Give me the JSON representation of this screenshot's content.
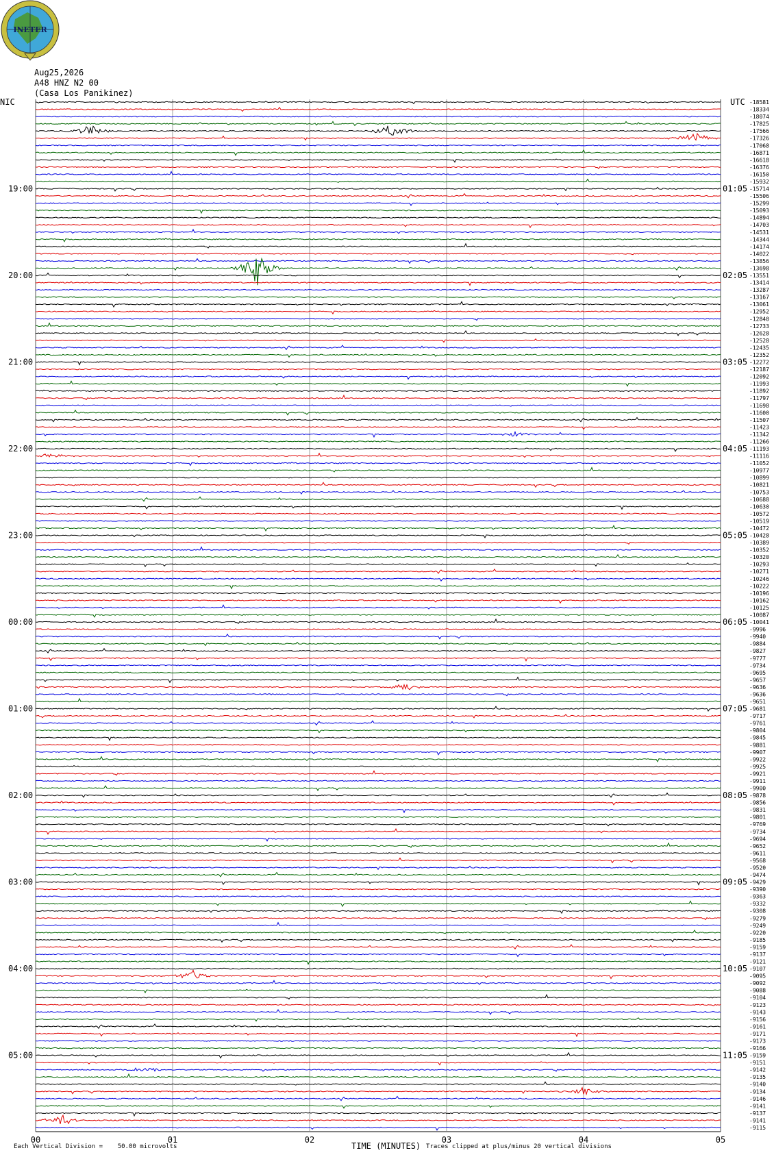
{
  "logo": {
    "text": "INETER"
  },
  "header": {
    "date": "Aug25,2026",
    "station": "A48 HNZ N2 00",
    "location": "(Casa Los Panikinez)"
  },
  "left_zone": "NIC",
  "right_zone": "UTC",
  "chart_data": {
    "type": "line",
    "title": "",
    "xlabel": "TIME (MINUTES)",
    "x_ticks": [
      "00",
      "01",
      "02",
      "03",
      "04",
      "05"
    ],
    "xlim": [
      0,
      5
    ],
    "trace_colors": [
      "#000000",
      "#e00000",
      "#0000e0",
      "#006600"
    ],
    "left_time_labels": [
      "19:00",
      "20:00",
      "21:00",
      "22:00",
      "23:00",
      "00:00",
      "01:00",
      "02:00",
      "03:00",
      "04:00",
      "05:00"
    ],
    "right_time_labels": [
      "01:05",
      "02:05",
      "03:05",
      "04:05",
      "05:05",
      "06:05",
      "07:05",
      "08:05",
      "09:05",
      "10:05",
      "11:05"
    ],
    "trace_offsets": [
      "-18581",
      "-18334",
      "-18074",
      "-17825",
      "-17566",
      "-17326",
      "-17068",
      "-16871",
      "-16618",
      "-16376",
      "-16150",
      "-15932",
      "-15714",
      "-15506",
      "-15299",
      "-15093",
      "-14894",
      "-14703",
      "-14531",
      "-14344",
      "-14174",
      "-14022",
      "-13856",
      "-13698",
      "-13551",
      "-13414",
      "-13287",
      "-13167",
      "-13061",
      "-12952",
      "-12840",
      "-12733",
      "-12628",
      "-12528",
      "-12435",
      "-12352",
      "-12272",
      "-12187",
      "-12092",
      "-11993",
      "-11892",
      "-11797",
      "-11698",
      "-11600",
      "-11507",
      "-11423",
      "-11342",
      "-11266",
      "-11193",
      "-11116",
      "-11052",
      "-10977",
      "-10899",
      "-10821",
      "-10753",
      "-10688",
      "-10630",
      "-10572",
      "-10519",
      "-10472",
      "-10428",
      "-10389",
      "-10352",
      "-10320",
      "-10293",
      "-10271",
      "-10246",
      "-10222",
      "-10196",
      "-10162",
      "-10125",
      "-10087",
      "-10041",
      "-9996",
      "-9940",
      "-9884",
      "-9827",
      "-9777",
      "-9734",
      "-9695",
      "-9657",
      "-9636",
      "-9636",
      "-9651",
      "-9681",
      "-9717",
      "-9761",
      "-9804",
      "-9845",
      "-9881",
      "-9907",
      "-9922",
      "-9925",
      "-9921",
      "-9911",
      "-9900",
      "-9878",
      "-9856",
      "-9831",
      "-9801",
      "-9769",
      "-9734",
      "-9694",
      "-9652",
      "-9611",
      "-9568",
      "-9520",
      "-9474",
      "-9429",
      "-9390",
      "-9363",
      "-9332",
      "-9308",
      "-9279",
      "-9249",
      "-9220",
      "-9185",
      "-9159",
      "-9137",
      "-9121",
      "-9107",
      "-9095",
      "-9092",
      "-9088",
      "-9104",
      "-9123",
      "-9143",
      "-9156",
      "-9161",
      "-9171",
      "-9173",
      "-9166",
      "-9159",
      "-9151",
      "-9142",
      "-9135",
      "-9140",
      "-9134",
      "-9146",
      "-9141",
      "-9137",
      "-9141",
      "-9115"
    ],
    "footnote_scale": "Each Vertical Division =    50.00 microvolts",
    "footnote_clip": "Traces clipped at plus/minus 20 vertical divisions",
    "events": [
      {
        "trace": 23,
        "minute": 1.62,
        "amp": 26,
        "color_index": 3
      },
      {
        "trace": 4,
        "minute": 0.4,
        "amp": 10,
        "color_index": 0
      },
      {
        "trace": 4,
        "minute": 2.6,
        "amp": 12,
        "color_index": 0
      },
      {
        "trace": 5,
        "minute": 4.8,
        "amp": 10,
        "color_index": 1
      },
      {
        "trace": 46,
        "minute": 3.5,
        "amp": 4,
        "color_index": 0
      },
      {
        "trace": 49,
        "minute": 0.1,
        "amp": 5,
        "color_index": 1
      },
      {
        "trace": 81,
        "minute": 2.7,
        "amp": 6,
        "color_index": 0
      },
      {
        "trace": 121,
        "minute": 1.15,
        "amp": 9,
        "color_index": 1
      },
      {
        "trace": 134,
        "minute": 0.8,
        "amp": 6,
        "color_index": 2
      },
      {
        "trace": 137,
        "minute": 4.0,
        "amp": 6,
        "color_index": 2
      },
      {
        "trace": 141,
        "minute": 0.2,
        "amp": 10,
        "color_index": 2
      }
    ]
  }
}
